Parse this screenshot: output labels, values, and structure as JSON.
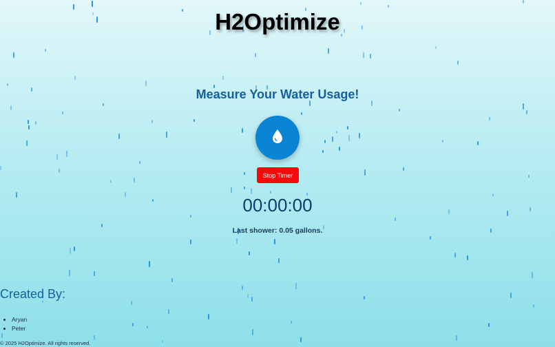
{
  "app": {
    "title": "H2Optimize"
  },
  "main": {
    "heading": "Measure Your Water Usage!",
    "water_button_icon": "water-drop-icon",
    "stop_button_label": "Stop Timer",
    "timer_display": "00:00:00",
    "last_shower_text": "Last shower: 0.05 gallons."
  },
  "credits": {
    "heading": "Created By:",
    "names": [
      "Aryan",
      "Peter"
    ]
  },
  "footer": {
    "text": "© 2025 H2Optimize. All rights reserved."
  },
  "colors": {
    "accent": "#0a84d4",
    "stop": "#f50a0a",
    "heading": "#14609c",
    "rain": "#1f8fe0"
  }
}
